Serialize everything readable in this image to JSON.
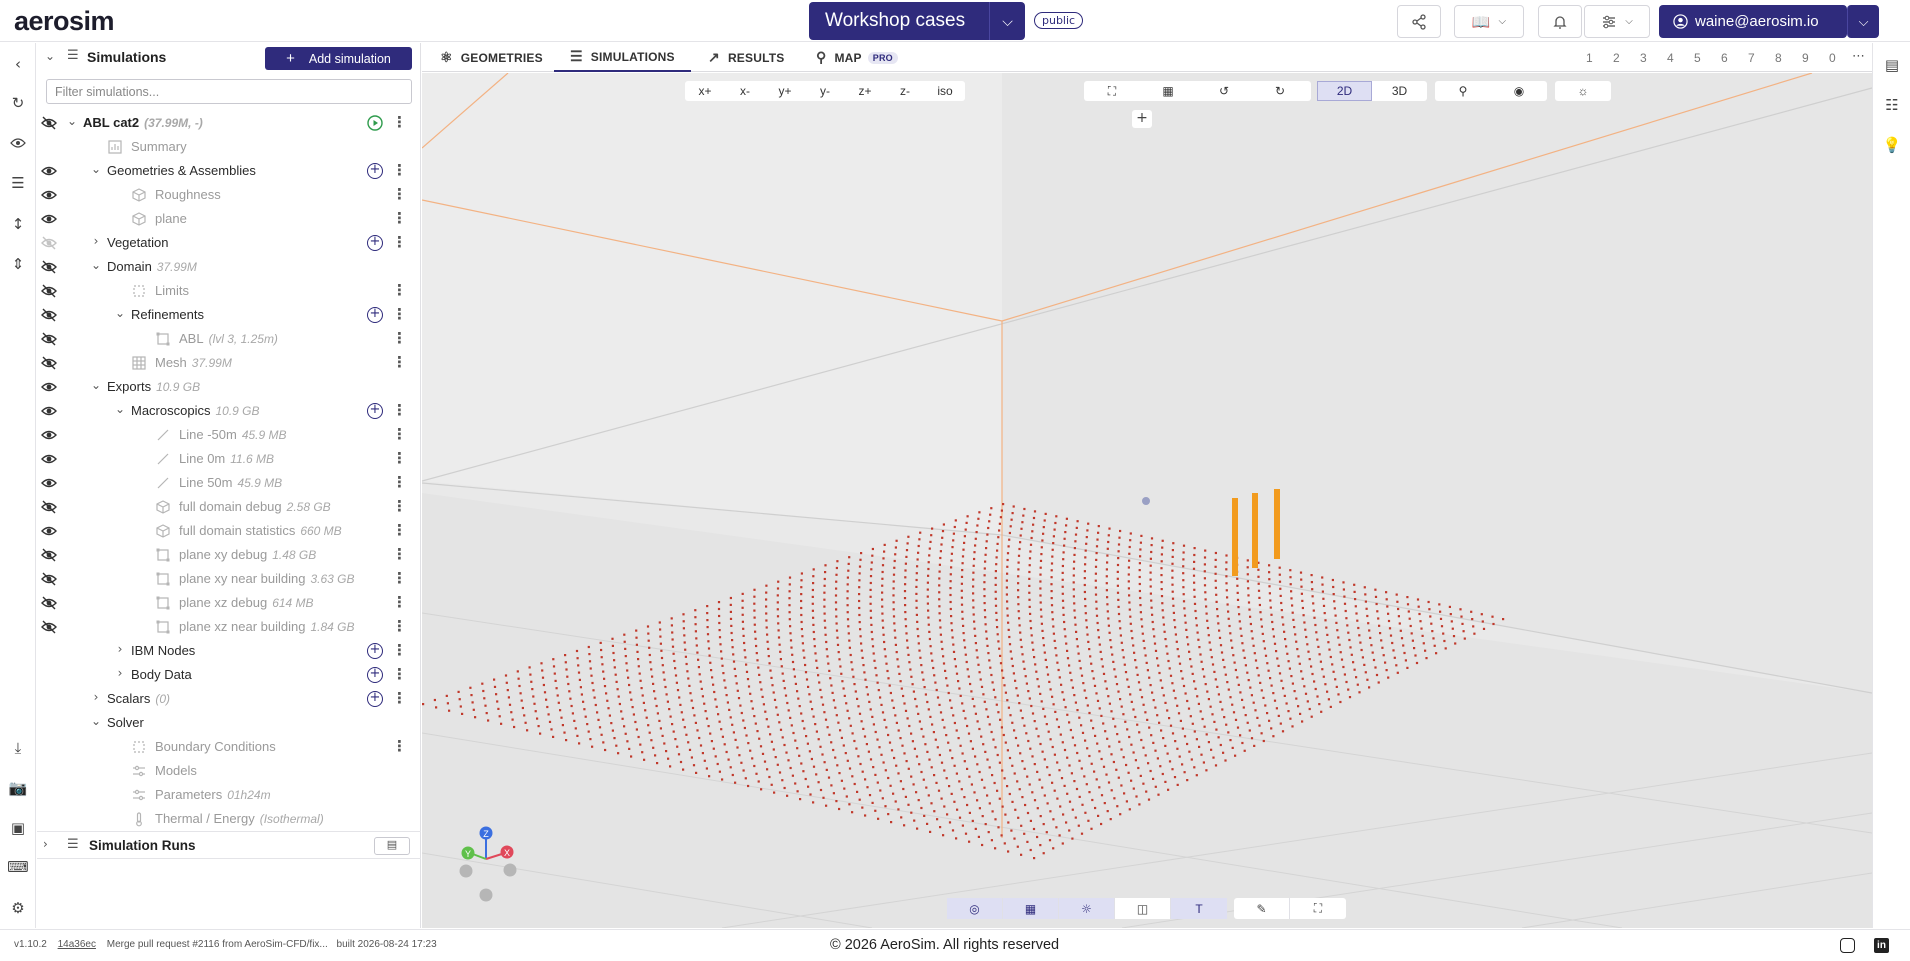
{
  "app": {
    "logo": "aerosim",
    "project": "Workshop cases",
    "visibility": "public",
    "user": "waine@aerosim.io"
  },
  "colors": {
    "brand": "#2f2b7c",
    "probe_points": "#c0392b",
    "building": "#f29b1e",
    "domain_edge": "#f3b283"
  },
  "panel": {
    "title": "Simulations",
    "add_label": "Add simulation",
    "filter_placeholder": "Filter simulations...",
    "runs_label": "Simulation Runs"
  },
  "tree": [
    {
      "label": "ABL cat2",
      "meta": "(37.99M, -)",
      "style": "bold",
      "eye": "closed",
      "caret": "open",
      "action": "play",
      "kebab": true,
      "level": 0,
      "icon": ""
    },
    {
      "label": "Summary",
      "meta": "",
      "style": "dim",
      "eye": "",
      "caret": "",
      "action": "",
      "kebab": false,
      "level": 1,
      "icon": "chart-icon"
    },
    {
      "label": "Geometries & Assemblies",
      "meta": "",
      "style": "dark",
      "eye": "open",
      "caret": "open",
      "action": "plus",
      "kebab": true,
      "level": 1,
      "icon": ""
    },
    {
      "label": "Roughness",
      "meta": "",
      "style": "dim",
      "eye": "open",
      "caret": "",
      "action": "",
      "kebab": true,
      "level": 2,
      "icon": "cube-icon"
    },
    {
      "label": "plane",
      "meta": "",
      "style": "dim",
      "eye": "open",
      "caret": "",
      "action": "",
      "kebab": true,
      "level": 2,
      "icon": "cube-icon"
    },
    {
      "label": "Vegetation",
      "meta": "",
      "style": "dark",
      "eye": "faded",
      "caret": "closed",
      "action": "plus",
      "kebab": true,
      "level": 1,
      "icon": ""
    },
    {
      "label": "Domain",
      "meta": "37.99M",
      "style": "dark",
      "eye": "closed",
      "caret": "open",
      "action": "",
      "kebab": false,
      "level": 1,
      "icon": ""
    },
    {
      "label": "Limits",
      "meta": "",
      "style": "dim",
      "eye": "closed",
      "caret": "",
      "action": "",
      "kebab": true,
      "level": 2,
      "icon": "bounds-icon"
    },
    {
      "label": "Refinements",
      "meta": "",
      "style": "dark",
      "eye": "closed",
      "caret": "open",
      "action": "plus",
      "kebab": true,
      "level": 2,
      "icon": ""
    },
    {
      "label": "ABL",
      "meta": "(lvl 3, 1.25m)",
      "style": "dim",
      "eye": "closed",
      "caret": "",
      "action": "",
      "kebab": true,
      "level": 3,
      "icon": "box-icon"
    },
    {
      "label": "Mesh",
      "meta": "37.99M",
      "style": "dim",
      "eye": "closed",
      "caret": "",
      "action": "",
      "kebab": true,
      "level": 2,
      "icon": "grid-icon"
    },
    {
      "label": "Exports",
      "meta": "10.9 GB",
      "style": "dark",
      "eye": "open",
      "caret": "open",
      "action": "",
      "kebab": false,
      "level": 1,
      "icon": ""
    },
    {
      "label": "Macroscopics",
      "meta": "10.9 GB",
      "style": "dark",
      "eye": "open",
      "caret": "open",
      "action": "plus",
      "kebab": true,
      "level": 2,
      "icon": ""
    },
    {
      "label": "Line -50m",
      "meta": "45.9 MB",
      "style": "dim",
      "eye": "open",
      "caret": "",
      "action": "",
      "kebab": true,
      "level": 3,
      "icon": "line-icon"
    },
    {
      "label": "Line 0m",
      "meta": "11.6 MB",
      "style": "dim",
      "eye": "open",
      "caret": "",
      "action": "",
      "kebab": true,
      "level": 3,
      "icon": "line-icon"
    },
    {
      "label": "Line 50m",
      "meta": "45.9 MB",
      "style": "dim",
      "eye": "open",
      "caret": "",
      "action": "",
      "kebab": true,
      "level": 3,
      "icon": "line-icon"
    },
    {
      "label": "full domain debug",
      "meta": "2.58 GB",
      "style": "dim",
      "eye": "closed",
      "caret": "",
      "action": "",
      "kebab": true,
      "level": 3,
      "icon": "cube-icon"
    },
    {
      "label": "full domain statistics",
      "meta": "660 MB",
      "style": "dim",
      "eye": "open",
      "caret": "",
      "action": "",
      "kebab": true,
      "level": 3,
      "icon": "cube-icon"
    },
    {
      "label": "plane xy debug",
      "meta": "1.48 GB",
      "style": "dim",
      "eye": "closed",
      "caret": "",
      "action": "",
      "kebab": true,
      "level": 3,
      "icon": "box-icon"
    },
    {
      "label": "plane xy near building",
      "meta": "3.63 GB",
      "style": "dim",
      "eye": "closed",
      "caret": "",
      "action": "",
      "kebab": true,
      "level": 3,
      "icon": "box-icon"
    },
    {
      "label": "plane xz debug",
      "meta": "614 MB",
      "style": "dim",
      "eye": "closed",
      "caret": "",
      "action": "",
      "kebab": true,
      "level": 3,
      "icon": "box-icon"
    },
    {
      "label": "plane xz near building",
      "meta": "1.84 GB",
      "style": "dim",
      "eye": "closed",
      "caret": "",
      "action": "",
      "kebab": true,
      "level": 3,
      "icon": "box-icon"
    },
    {
      "label": "IBM Nodes",
      "meta": "",
      "style": "dark",
      "eye": "",
      "caret": "closed",
      "action": "plus",
      "kebab": true,
      "level": 2,
      "icon": ""
    },
    {
      "label": "Body Data",
      "meta": "",
      "style": "dark",
      "eye": "",
      "caret": "closed",
      "action": "plus",
      "kebab": true,
      "level": 2,
      "icon": ""
    },
    {
      "label": "Scalars",
      "meta": "(0)",
      "style": "dark",
      "eye": "",
      "caret": "closed",
      "action": "plus",
      "kebab": true,
      "level": 1,
      "icon": ""
    },
    {
      "label": "Solver",
      "meta": "",
      "style": "dark",
      "eye": "",
      "caret": "open",
      "action": "",
      "kebab": false,
      "level": 1,
      "icon": ""
    },
    {
      "label": "Boundary Conditions",
      "meta": "",
      "style": "dim",
      "eye": "",
      "caret": "",
      "action": "",
      "kebab": true,
      "level": 2,
      "icon": "bounds-icon"
    },
    {
      "label": "Models",
      "meta": "",
      "style": "dim",
      "eye": "",
      "caret": "",
      "action": "",
      "kebab": false,
      "level": 2,
      "icon": "sliders-icon"
    },
    {
      "label": "Parameters",
      "meta": "01h24m",
      "style": "dim",
      "eye": "",
      "caret": "",
      "action": "",
      "kebab": false,
      "level": 2,
      "icon": "sliders-icon"
    },
    {
      "label": "Thermal / Energy",
      "meta": "(Isothermal)",
      "style": "dim",
      "eye": "",
      "caret": "",
      "action": "",
      "kebab": false,
      "level": 2,
      "icon": "thermometer-icon"
    }
  ],
  "tabs": [
    {
      "label": "GEOMETRIES",
      "icon": "shapes-icon"
    },
    {
      "label": "SIMULATIONS",
      "icon": "list-icon"
    },
    {
      "label": "RESULTS",
      "icon": "chart-line-icon"
    },
    {
      "label": "MAP",
      "icon": "pin-icon",
      "badge": "PRO"
    }
  ],
  "active_tab": "SIMULATIONS",
  "view_slots": [
    "1",
    "2",
    "3",
    "4",
    "5",
    "6",
    "7",
    "8",
    "9",
    "0"
  ],
  "view_buttons": [
    "x+",
    "x-",
    "y+",
    "y-",
    "z+",
    "z-",
    "iso"
  ],
  "dim_toggle": [
    "2D",
    "3D"
  ],
  "dim_selected": "2D",
  "axes": {
    "x": "X",
    "y": "Y",
    "z": "Z"
  },
  "bottom_tool_text": "T",
  "footer": {
    "version": "v1.10.2",
    "hash": "14a36ec",
    "commit": "Merge pull request #2116 from AeroSim-CFD/fix...",
    "built": "built 2026-08-24 17:23",
    "copyright": "© 2026 AeroSim. All rights reserved"
  }
}
